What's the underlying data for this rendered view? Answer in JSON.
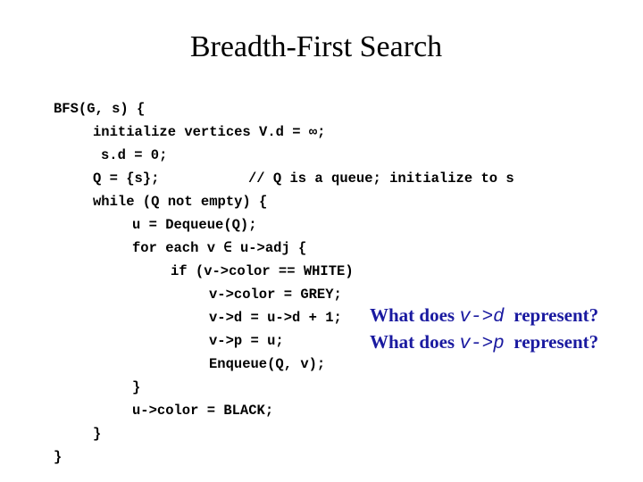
{
  "title": "Breadth-First Search",
  "code_lines": [
    {
      "text": "BFS(G, s) {"
    },
    {
      "text": "initialize vertices V.d = ∞;"
    },
    {
      "text": "s.d = 0;"
    },
    {
      "text": "Q = {s};",
      "comment": "// Q is a queue; initialize to s"
    },
    {
      "text": "while (Q not empty) {"
    },
    {
      "text": "u = Dequeue(Q);"
    },
    {
      "text": "for each v ∈ u->adj {"
    },
    {
      "text": "if (v->color == WHITE)"
    },
    {
      "text": "v->color = GREY;"
    },
    {
      "text": "v->d = u->d + 1;"
    },
    {
      "text": "v->p = u;"
    },
    {
      "text": "Enqueue(Q, v);"
    },
    {
      "text": "}"
    },
    {
      "text": "u->color = BLACK;"
    },
    {
      "text": "}"
    },
    {
      "text": "}"
    }
  ],
  "questions": [
    {
      "prefix": "What does ",
      "code": "v->d",
      "suffix": "  represent?"
    },
    {
      "prefix": "What does ",
      "code": "v->p",
      "suffix": "  represent?"
    }
  ],
  "colors": {
    "question": "#1a1aa0"
  }
}
